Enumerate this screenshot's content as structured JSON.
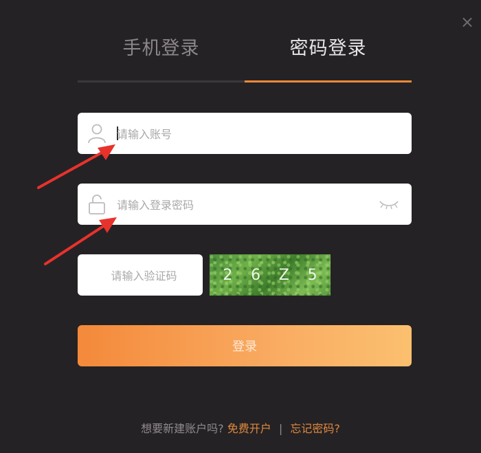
{
  "dialog": {
    "close_glyph": "×"
  },
  "tabs": [
    {
      "label": "手机登录",
      "active": false
    },
    {
      "label": "密码登录",
      "active": true
    }
  ],
  "account": {
    "placeholder": "请输入账号",
    "icon": "user-icon"
  },
  "password": {
    "placeholder": "请输入登录密码",
    "icon": "lock-icon",
    "toggle_icon": "eye-closed-icon"
  },
  "captcha": {
    "placeholder": "请输入验证码",
    "chars": [
      "2",
      "6",
      "Z",
      "5"
    ]
  },
  "login": {
    "label": "登录"
  },
  "footer": {
    "prompt": "想要新建账户吗?",
    "register_link": "免费开户",
    "separator": "|",
    "forgot_link": "忘记密码?"
  },
  "colors": {
    "background": "#252225",
    "accent": "#f08a3a",
    "annotation_arrow": "#e8322c"
  }
}
